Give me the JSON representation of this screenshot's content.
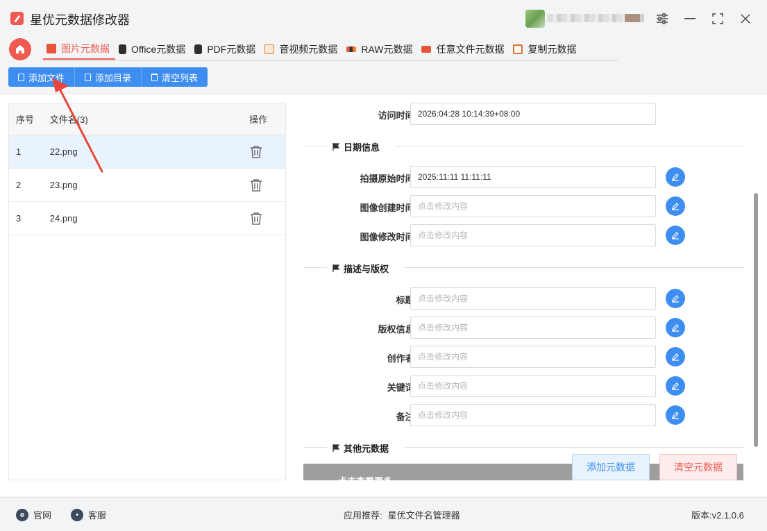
{
  "app": {
    "title": "星优元数据修改器"
  },
  "tabs": [
    {
      "label": "图片元数据",
      "color": "#e8553b"
    },
    {
      "label": "Office元数据",
      "color": "#333333"
    },
    {
      "label": "PDF元数据",
      "color": "#333333"
    },
    {
      "label": "音视频元数据",
      "color": "#f07a2a"
    },
    {
      "label": "RAW元数据",
      "color": "#ef5a50"
    },
    {
      "label": "任意文件元数据",
      "color": "#e8553b"
    },
    {
      "label": "复制元数据",
      "color": "#e86f2e"
    }
  ],
  "toolbar": {
    "add_file": "添加文件",
    "add_dir": "添加目录",
    "clear_list": "清空列表"
  },
  "filelist": {
    "headers": {
      "index": "序号",
      "name": "文件名(3)",
      "op": "操作"
    },
    "rows": [
      {
        "index": "1",
        "name": "22.png"
      },
      {
        "index": "2",
        "name": "23.png"
      },
      {
        "index": "3",
        "name": "24.png"
      }
    ]
  },
  "detail": {
    "access_time": {
      "label": "访问时间:",
      "value": "2026:04:28 10:14:39+08:00"
    },
    "section_date": "日期信息",
    "shoot_time": {
      "label": "拍摄原始时间:",
      "value": "2025:11:11 11:11:11"
    },
    "create_time": {
      "label": "图像创建时间:",
      "placeholder": "点击修改内容"
    },
    "modify_time": {
      "label": "图像修改时间:",
      "placeholder": "点击修改内容"
    },
    "section_desc": "描述与版权",
    "title": {
      "label": "标题:",
      "placeholder": "点击修改内容"
    },
    "copyright": {
      "label": "版权信息:",
      "placeholder": "点击修改内容"
    },
    "creator": {
      "label": "创作者:",
      "placeholder": "点击修改内容"
    },
    "keywords": {
      "label": "关键词:",
      "placeholder": "点击修改内容"
    },
    "remark": {
      "label": "备注:",
      "placeholder": "点击修改内容"
    },
    "section_other": "其他元数据",
    "more_bar": "点击查看更多"
  },
  "actions": {
    "add_meta": "添加元数据",
    "clear_meta": "清空元数据"
  },
  "footer": {
    "website": "官网",
    "service": "客服",
    "recommend_label": "应用推荐:",
    "recommend_app": "星优文件名管理器",
    "version": "版本:v2.1.0.6"
  },
  "colors": {
    "accent_red": "#ef5a50",
    "accent_blue": "#3d8ef0"
  }
}
